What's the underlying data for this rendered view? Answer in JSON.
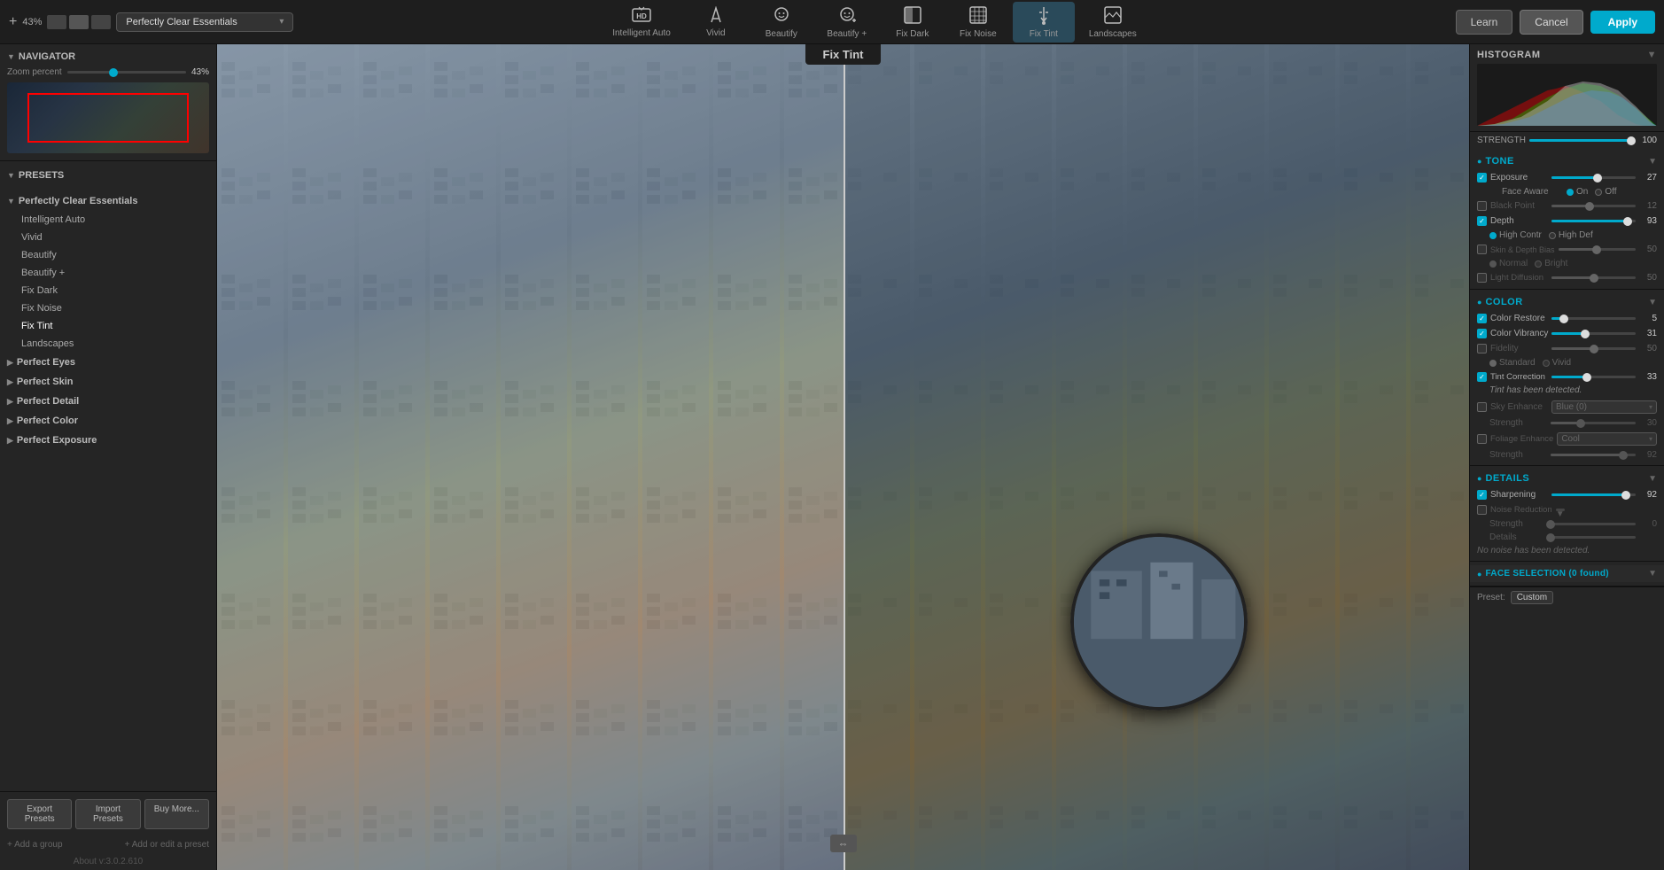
{
  "topbar": {
    "plus_label": "+",
    "zoom_value": "43%",
    "preset_name": "Perfectly Clear Essentials",
    "dropdown_arrow": "▾",
    "tools": [
      {
        "id": "intelligent-auto",
        "label": "Intelligent Auto",
        "icon": "⬛",
        "active": false
      },
      {
        "id": "vivid",
        "label": "Vivid",
        "icon": "✏️",
        "active": false
      },
      {
        "id": "beautify",
        "label": "Beautify",
        "icon": "😊",
        "active": false
      },
      {
        "id": "beautify-plus",
        "label": "Beautify +",
        "icon": "😍",
        "active": false
      },
      {
        "id": "fix-dark",
        "label": "Fix Dark",
        "icon": "⬜",
        "active": false
      },
      {
        "id": "fix-noise",
        "label": "Fix Noise",
        "icon": "🔲",
        "active": false
      },
      {
        "id": "fix-tint",
        "label": "Fix Tint",
        "icon": "🌡",
        "active": true
      },
      {
        "id": "landscapes",
        "label": "Landscapes",
        "icon": "🏔",
        "active": false
      }
    ],
    "learn_label": "Learn",
    "cancel_label": "Cancel",
    "apply_label": "Apply"
  },
  "navigator": {
    "section_label": "NAVIGATOR",
    "zoom_label": "Zoom percent",
    "zoom_value": "43%",
    "zoom_pct": 35
  },
  "presets": {
    "section_label": "PRESETS",
    "groups": [
      {
        "name": "Perfectly Clear Essentials",
        "expanded": true,
        "items": [
          "Intelligent Auto",
          "Vivid",
          "Beautify",
          "Beautify +",
          "Fix Dark",
          "Fix Noise",
          "Fix Tint",
          "Landscapes"
        ]
      },
      {
        "name": "Perfect Eyes",
        "expanded": false,
        "items": []
      },
      {
        "name": "Perfect Skin",
        "expanded": false,
        "items": []
      },
      {
        "name": "Perfect Detail",
        "expanded": false,
        "items": []
      },
      {
        "name": "Perfect Color",
        "expanded": false,
        "items": []
      },
      {
        "name": "Perfect Exposure",
        "expanded": false,
        "items": []
      }
    ],
    "active_item": "Fix Tint",
    "add_group_label": "+ Add a group",
    "add_preset_label": "+ Add or edit a preset"
  },
  "footer_buttons": {
    "export": "Export Presets",
    "import": "Import Presets",
    "buy": "Buy More..."
  },
  "about": "About v:3.0.2.610",
  "image": {
    "center_label": "Fix Tint"
  },
  "right_panel": {
    "histogram_label": "HISTOGRAM",
    "strength_label": "STRENGTH",
    "strength_value": "100",
    "strength_pct": 100,
    "sections": {
      "tone": {
        "label": "TONE",
        "controls": [
          {
            "name": "Exposure",
            "checked": true,
            "value": "27",
            "pct": 55,
            "disabled": false
          },
          {
            "name": "Face Aware",
            "type": "onoff",
            "selected": "On"
          },
          {
            "name": "Black Point",
            "checked": false,
            "value": "12",
            "pct": 45,
            "disabled": true
          },
          {
            "name": "Depth",
            "checked": true,
            "value": "93",
            "pct": 90,
            "disabled": false,
            "sub": {
              "options": [
                "High Contr",
                "High Def"
              ],
              "selected": "High Contr"
            }
          },
          {
            "name": "Skin & Depth Bias",
            "checked": false,
            "value": "50",
            "pct": 50,
            "disabled": true,
            "sub": {
              "options": [
                "Normal",
                "Bright"
              ],
              "selected": "Normal"
            }
          },
          {
            "name": "Light Diffusion",
            "checked": false,
            "value": "50",
            "pct": 50,
            "disabled": true
          }
        ]
      },
      "color": {
        "label": "COLOR",
        "controls": [
          {
            "name": "Color Restore",
            "checked": true,
            "value": "5",
            "pct": 15,
            "disabled": false
          },
          {
            "name": "Color Vibrancy",
            "checked": true,
            "value": "31",
            "pct": 40,
            "disabled": false
          },
          {
            "name": "Fidelity",
            "checked": false,
            "value": "50",
            "pct": 50,
            "disabled": true,
            "sub": {
              "options": [
                "Standard",
                "Vivid"
              ],
              "selected": "Standard"
            }
          },
          {
            "name": "Tint Correction",
            "checked": true,
            "value": "33",
            "pct": 42,
            "disabled": false
          },
          {
            "name": "tint_msg",
            "type": "message",
            "text": "Tint has been detected."
          },
          {
            "name": "Sky Enhance",
            "checked": false,
            "value": "Blue (0)",
            "type": "dropdown",
            "disabled": true
          },
          {
            "name": "Strength",
            "checked": false,
            "indent": true,
            "value": "30",
            "pct": 35,
            "disabled": true
          },
          {
            "name": "Foliage Enhance",
            "checked": false,
            "value": "Cool",
            "type": "dropdown",
            "disabled": true
          },
          {
            "name": "Strength2",
            "label": "Strength",
            "checked": false,
            "indent": true,
            "value": "92",
            "pct": 85,
            "disabled": true
          }
        ]
      },
      "details": {
        "label": "DETAILS",
        "controls": [
          {
            "name": "Sharpening",
            "checked": true,
            "value": "92",
            "pct": 88,
            "disabled": false
          },
          {
            "name": "Noise Reduction",
            "checked": false,
            "value": "",
            "type": "header_only",
            "disabled": true
          },
          {
            "name": "Strength_noise",
            "label": "Strength",
            "indent": true,
            "value": "0",
            "pct": 0,
            "disabled": true
          },
          {
            "name": "Details_noise",
            "label": "Details",
            "indent": true,
            "value": "",
            "pct": 0,
            "disabled": true
          },
          {
            "name": "noise_msg",
            "type": "message",
            "text": "No noise has been detected."
          }
        ]
      },
      "face_selection": {
        "label": "FACE SELECTION (0 found)"
      }
    },
    "bottom_preset": {
      "label": "Preset:",
      "value": "Custom"
    }
  }
}
